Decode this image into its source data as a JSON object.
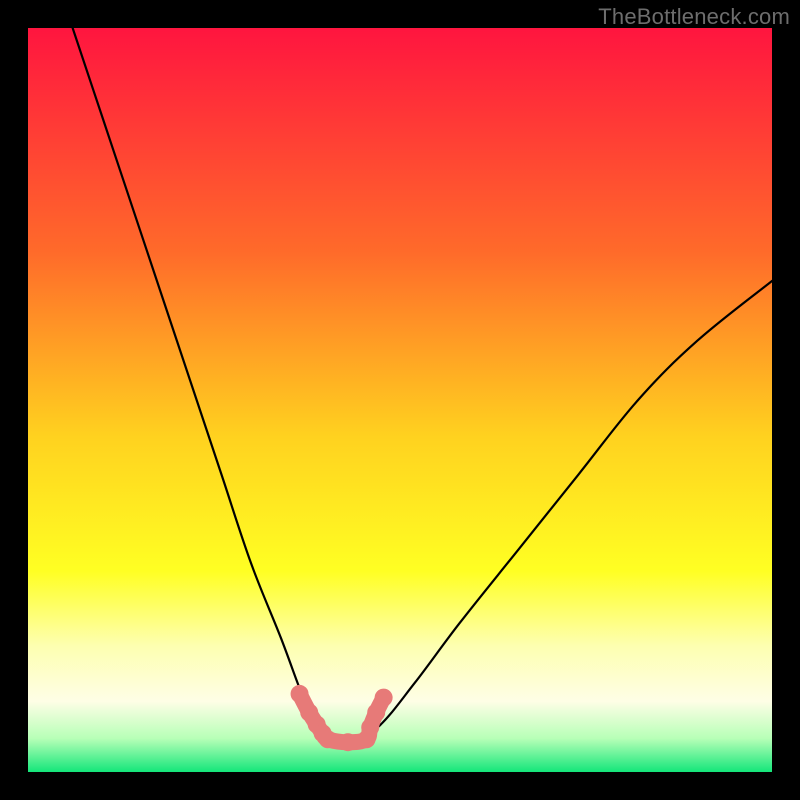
{
  "watermark": "TheBottleneck.com",
  "colors": {
    "background": "#000000",
    "grad_top": "#ff153f",
    "grad_mid1": "#ff6a2a",
    "grad_mid2": "#ffd21f",
    "grad_yellow": "#ffff23",
    "grad_pale": "#fdffb0",
    "grad_cream": "#fefee6",
    "grad_green_light": "#b7ffb7",
    "grad_green": "#14e67a",
    "curve": "#000000",
    "marker": "#e77a78"
  },
  "chart_data": {
    "type": "line",
    "title": "",
    "xlabel": "",
    "ylabel": "",
    "xlim": [
      0,
      100
    ],
    "ylim": [
      0,
      100
    ],
    "series": [
      {
        "name": "bottleneck-curve",
        "x": [
          6,
          10,
          14,
          18,
          22,
          26,
          30,
          34,
          37,
          39,
          41,
          43,
          47,
          52,
          58,
          66,
          74,
          82,
          90,
          100
        ],
        "y": [
          100,
          88,
          76,
          64,
          52,
          40,
          28,
          18,
          10,
          6,
          4,
          4,
          6,
          12,
          20,
          30,
          40,
          50,
          58,
          66
        ]
      }
    ],
    "highlight_segment": {
      "name": "bottom-notch",
      "x": [
        36.5,
        37.8,
        38.8,
        39.6,
        40.3,
        43.0,
        45.5,
        46.0,
        46.8,
        47.8
      ],
      "y": [
        10.5,
        8.0,
        6.4,
        5.2,
        4.4,
        4.0,
        4.4,
        6.0,
        8.0,
        10.0
      ]
    }
  }
}
